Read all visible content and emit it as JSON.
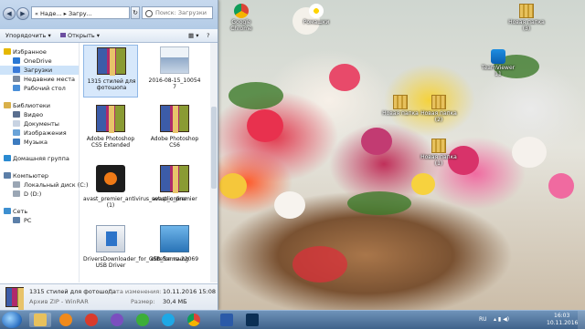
{
  "explorer": {
    "address": [
      "Наде...",
      "Загру..."
    ],
    "search_placeholder": "Поиск: Загрузки",
    "toolbar": {
      "organize": "Упорядочить",
      "open": "Открыть"
    },
    "sidebar": [
      {
        "label": "Избранное",
        "icon": "star-icon"
      },
      {
        "label": "OneDrive",
        "icon": "cloud-icon"
      },
      {
        "label": "Загрузки",
        "icon": "downloads-folder-icon",
        "selected": true
      },
      {
        "label": "Недавние места",
        "icon": "recent-places-icon"
      },
      {
        "label": "Рабочий стол",
        "icon": "desktop-icon"
      },
      {
        "label": "Библиотеки",
        "icon": "libraries-icon"
      },
      {
        "label": "Видео",
        "icon": "video-icon"
      },
      {
        "label": "Документы",
        "icon": "documents-icon"
      },
      {
        "label": "Изображения",
        "icon": "pictures-icon"
      },
      {
        "label": "Музыка",
        "icon": "music-icon"
      },
      {
        "label": "Домашняя группа",
        "icon": "homegroup-icon"
      },
      {
        "label": "Компьютер",
        "icon": "computer-icon"
      },
      {
        "label": "Локальный диск (C:)",
        "icon": "drive-icon"
      },
      {
        "label": "D (D:)",
        "icon": "drive-icon"
      },
      {
        "label": "Сеть",
        "icon": "network-icon"
      },
      {
        "label": "PC",
        "icon": "pc-icon"
      }
    ],
    "files": [
      {
        "name": "1315 стилей для фотошопа",
        "type": "rar",
        "selected": true
      },
      {
        "name": "2016-08-15_10054 7",
        "type": "image"
      },
      {
        "name": "Adobe Photoshop CS5 Extended",
        "type": "rar"
      },
      {
        "name": "Adobe Photoshop CS6",
        "type": "rar"
      },
      {
        "name": "avast_premier_antivirus_setup_online (1)",
        "type": "avast"
      },
      {
        "name": "avastlic_premier",
        "type": "rar"
      },
      {
        "name": "DriversDownloader_for_GSB_Samsung USB Driver",
        "type": "installer"
      },
      {
        "name": "elitefon.ru-22069",
        "type": "image"
      }
    ],
    "details": {
      "name": "1315 стилей для фотошопа",
      "type": "Архив ZIP - WinRAR",
      "modified_label": "Дата изменения:",
      "modified_value": "10.11.2016 15:08",
      "size_label": "Размер:",
      "size_value": "30,4 МБ"
    }
  },
  "desktop_icons": [
    {
      "label": "Google Chrome",
      "icon": "chrome-icon"
    },
    {
      "label": "Ромашки",
      "icon": "flowers-icon"
    },
    {
      "label": "Новая папка (3)",
      "icon": "zip-folder-icon"
    },
    {
      "label": "TeamViewer 11",
      "icon": "teamviewer-icon"
    },
    {
      "label": "Новая папка",
      "icon": "zip-folder-icon"
    },
    {
      "label": "Новая папка (2)",
      "icon": "zip-folder-icon"
    },
    {
      "label": "Новая папка (1)",
      "icon": "zip-folder-icon"
    }
  ],
  "taskbar": {
    "lang": "RU",
    "time": "16:03",
    "date": "10.11.2016"
  },
  "colors": {
    "taskbar": "#3f628b",
    "selection": "#cde3f9",
    "titlebar": "#c7d9ee"
  }
}
